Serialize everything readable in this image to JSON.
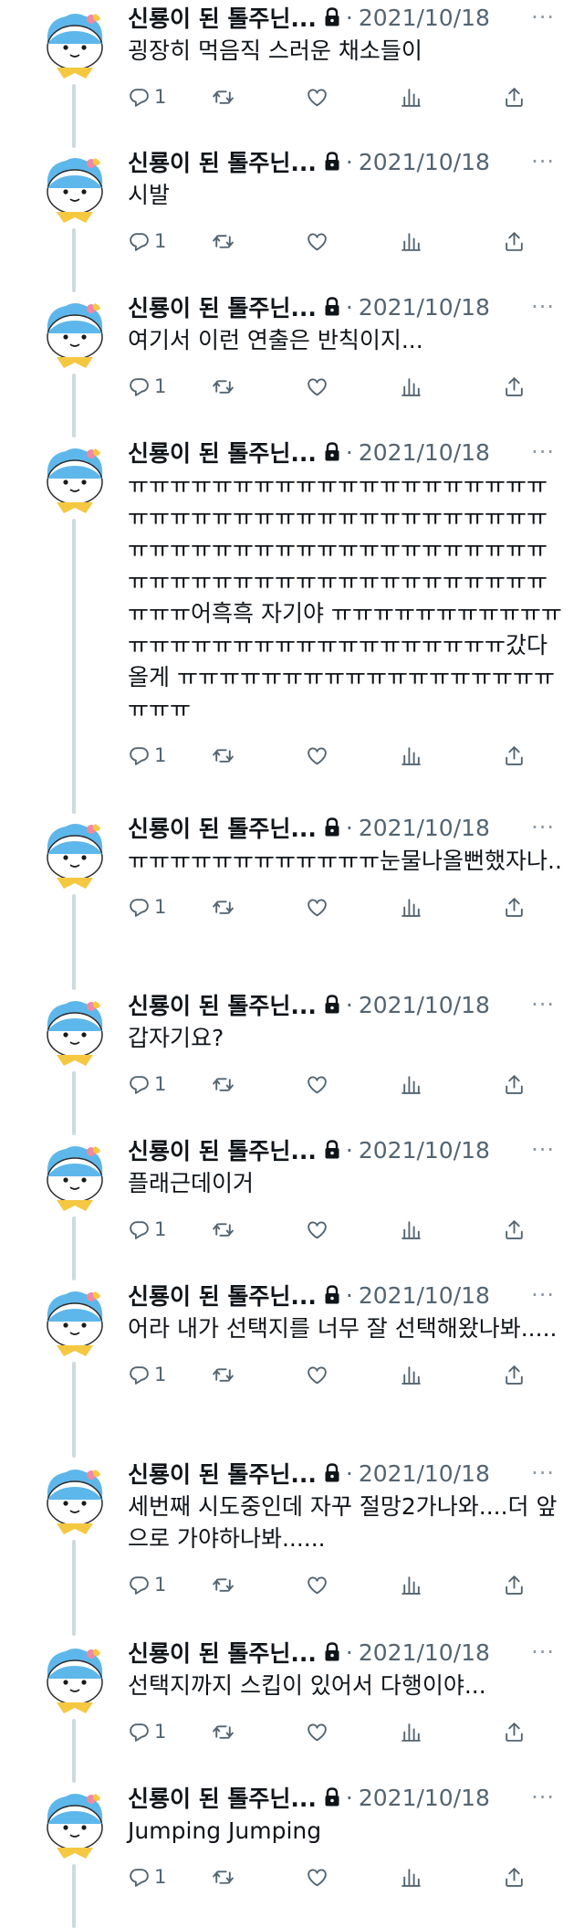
{
  "author": {
    "name": "신룡이 된 톨주닌...",
    "date": "2021/10/18",
    "separator": "·",
    "more": "···",
    "protected_icon": "lock-icon",
    "avatar_icon": "mascot-avatar"
  },
  "tweets": [
    {
      "text": "굉장히 먹음직 스러운 채소들이",
      "replies": "1"
    },
    {
      "text": "시발",
      "replies": "1"
    },
    {
      "text": "여기서 이런 연출은 반칙이지...",
      "replies": "1"
    },
    {
      "text": "ㅠㅠㅠㅠㅠㅠㅠㅠㅠㅠㅠㅠㅠㅠㅠㅠㅠㅠㅠㅠㅠㅠㅠㅠㅠㅠㅠㅠㅠㅠㅠㅠㅠㅠㅠㅠㅠㅠㅠㅠㅠㅠㅠㅠㅠㅠㅠㅠㅠㅠㅠㅠㅠㅠㅠㅠㅠㅠㅠㅠㅠㅠㅠㅠㅠㅠㅠㅠㅠㅠㅠㅠㅠㅠㅠㅠㅠㅠㅠㅠㅠㅠㅠ어흑흑 자기야 ㅠㅠㅠㅠㅠㅠㅠㅠㅠㅠㅠㅠㅠㅠㅠㅠㅠㅠㅠㅠㅠㅠㅠㅠㅠㅠㅠㅠㅠ갔다올게 ㅠㅠㅠㅠㅠㅠㅠㅠㅠㅠㅠㅠㅠㅠㅠㅠㅠㅠㅠㅠㅠ",
      "replies": "1"
    },
    {
      "text": "ㅠㅠㅠㅠㅠㅠㅠㅠㅠㅠㅠㅠ눈물나올뻔했자나..",
      "replies": "1"
    },
    {
      "text": "갑자기요?",
      "replies": "1"
    },
    {
      "text": "플래근데이거",
      "replies": "1"
    },
    {
      "text": "어라 내가 선택지를 너무 잘 선택해왔나봐.....",
      "replies": "1"
    },
    {
      "text": "세번째 시도중인데 자꾸 절망2가나와....더 앞으로 가야하나봐......",
      "replies": "1"
    },
    {
      "text": "선택지까지 스킵이 있어서 다행이야...",
      "replies": "1"
    },
    {
      "text": "Jumping Jumping",
      "replies": "1"
    }
  ],
  "colors": {
    "text": "#0f1419",
    "muted": "#536471",
    "thread_line": "#cfd9de",
    "avatar_blue": "#5eb7ea",
    "avatar_scarf": "#f5c842"
  }
}
